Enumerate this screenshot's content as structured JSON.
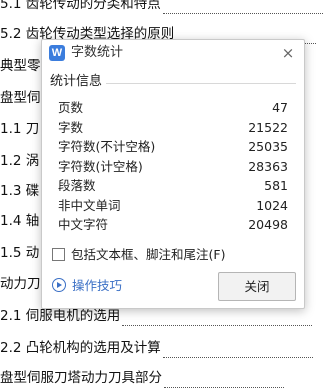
{
  "document": {
    "lines": [
      "5.1 齿轮传动的分类和特点",
      "5.2 齿轮传动类型选择的原则",
      "典型零",
      "盘型伺",
      "1.1  刀",
      "1.2  涡",
      "1.3  碟",
      "1.4  轴",
      "1.5  动",
      "动力刀块",
      "2.1 伺服电机的选用",
      "2.2 凸轮机构的选用及计算",
      "盘型伺服刀塔动力刀具部分"
    ]
  },
  "dialog": {
    "title": "字数统计",
    "app_icon": "W",
    "close_glyph": "×",
    "section_label": "统计信息",
    "stats": [
      {
        "label": "页数",
        "value": "47"
      },
      {
        "label": "字数",
        "value": "21522"
      },
      {
        "label": "字符数(不计空格)",
        "value": "25035"
      },
      {
        "label": "字符数(计空格)",
        "value": "28363"
      },
      {
        "label": "段落数",
        "value": "581"
      },
      {
        "label": "非中文单词",
        "value": "1024"
      },
      {
        "label": "中文字符",
        "value": "20498"
      }
    ],
    "checkbox_label": "包括文本框、脚注和尾注(F)",
    "checkbox_checked": false,
    "tips_label": "操作技巧",
    "close_button_label": "关闭"
  }
}
